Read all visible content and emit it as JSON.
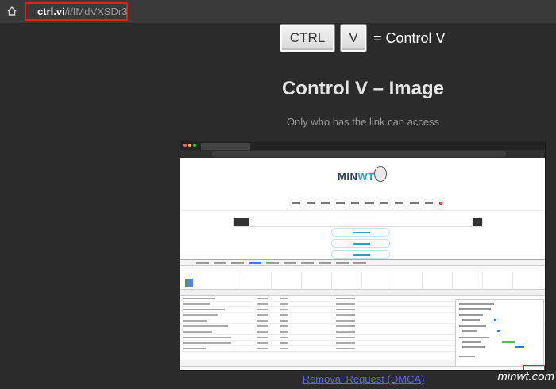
{
  "browser": {
    "url_host": "ctrl.vi",
    "url_path": "/i/fMdVXSDr3",
    "highlight_color": "#e0201a",
    "icons": [
      "home-icon",
      "lock-icon"
    ]
  },
  "logo": {
    "key_ctrl": "CTRL",
    "key_v": "V",
    "equals_text": "= Control V"
  },
  "content": {
    "headline": "Control V – Image",
    "subline": "Only who has the link can access",
    "removal_link": "Removal Request (DMCA)"
  },
  "watermark": "minwt.com",
  "colors": {
    "background": "#2b2b2b",
    "link": "#5b6be0"
  }
}
